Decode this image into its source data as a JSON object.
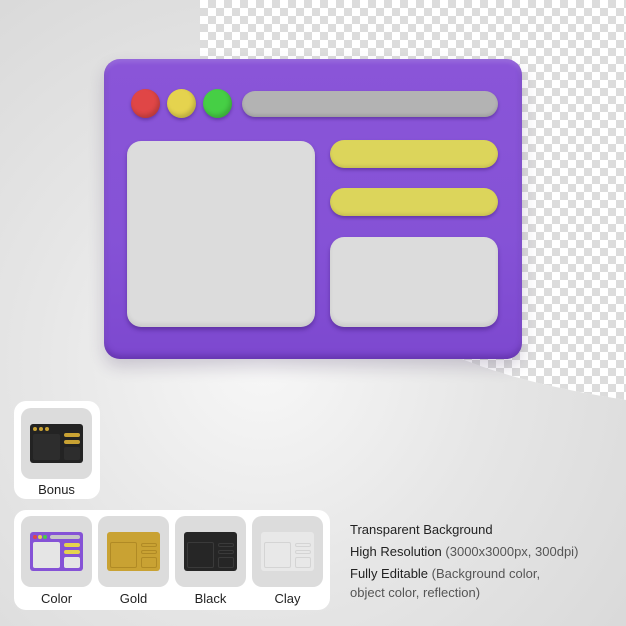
{
  "preview": {
    "subject": "3d-browser-window-icon",
    "colors": {
      "window": "#8552d6",
      "dot_red": "#e04646",
      "dot_yellow": "#e5d34e",
      "dot_green": "#46cf45",
      "url_bar": "#b3b3b3",
      "content_bar": "#dcd55b",
      "panel": "#dcdcdc"
    }
  },
  "bonus": {
    "label": "Bonus"
  },
  "variants": [
    {
      "label": "Color",
      "bg": "#8552d6",
      "accent": "#e5d34e",
      "panel": "#dcdcdc"
    },
    {
      "label": "Gold",
      "bg": "#c9a233",
      "accent": "#b8912a",
      "panel": "#c9a233"
    },
    {
      "label": "Black",
      "bg": "#2a2a2a",
      "accent": "#1f1f1f",
      "panel": "#2a2a2a"
    },
    {
      "label": "Clay",
      "bg": "#ececec",
      "accent": "#e2e2e2",
      "panel": "#ececec"
    }
  ],
  "features": [
    {
      "title": "Transparent Background",
      "detail": ""
    },
    {
      "title": "High Resolution",
      "detail": "(3000x3000px, 300dpi)"
    },
    {
      "title": "Fully Editable",
      "detail": "(Background color,",
      "detail2": "object color, reflection)"
    }
  ]
}
